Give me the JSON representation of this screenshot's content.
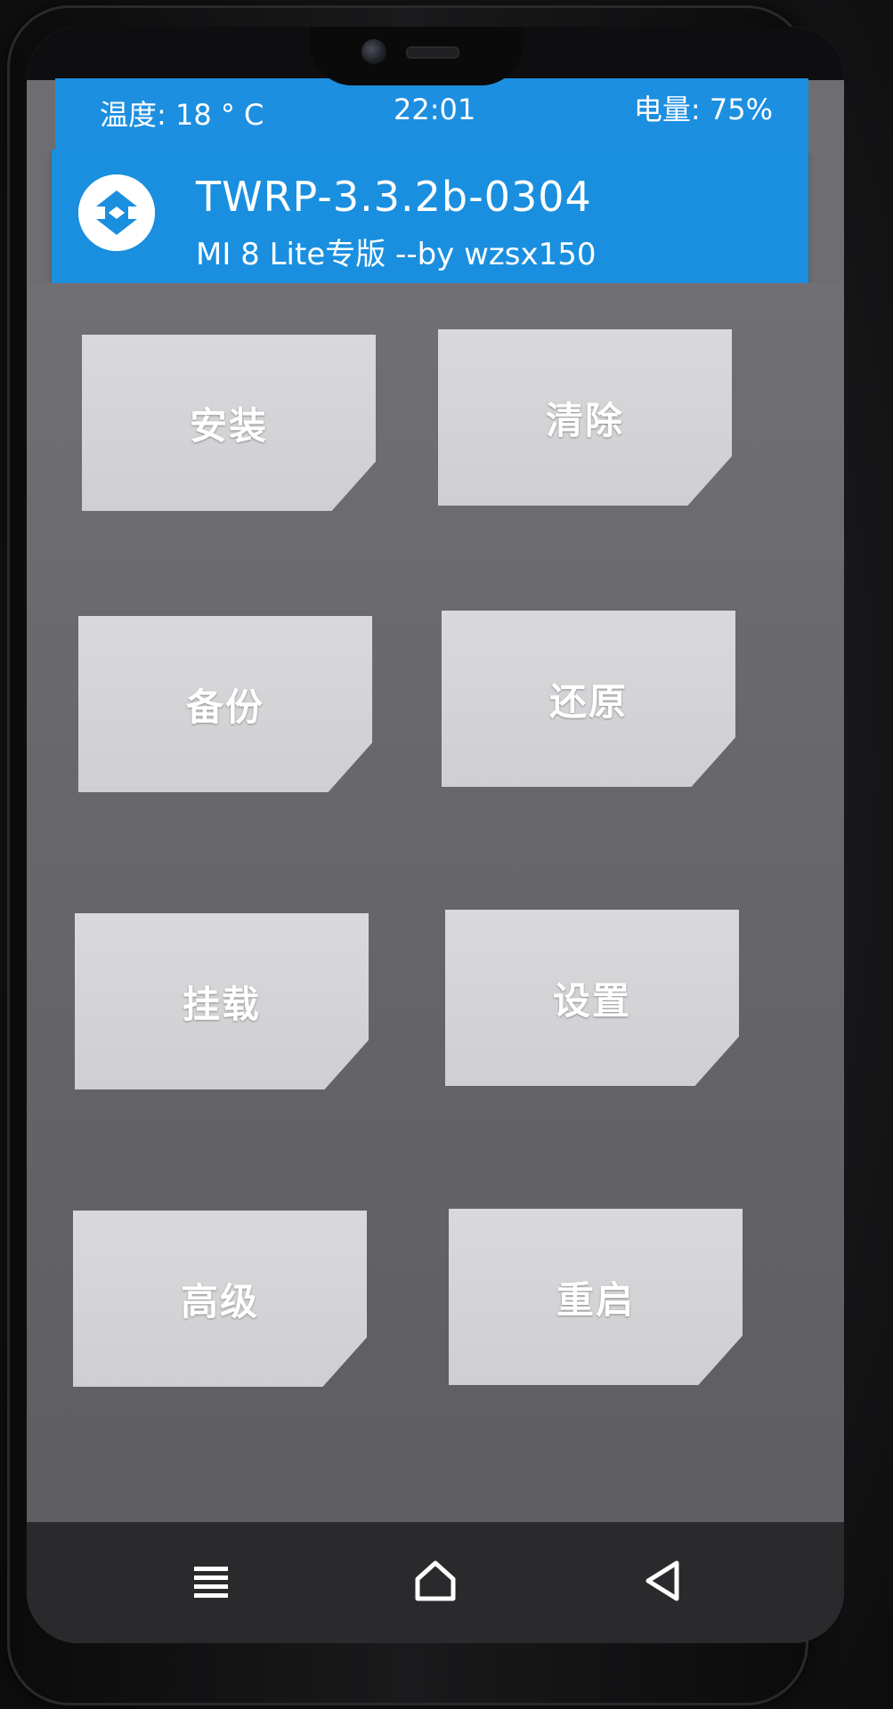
{
  "status_bar": {
    "temperature": "温度: 18 ° C",
    "time": "22:01",
    "battery": "电量: 75%"
  },
  "header": {
    "title": "TWRP-3.3.2b-0304",
    "subtitle": "MI 8 Lite专版  --by wzsx150",
    "logo_icon": "twrp-logo-icon"
  },
  "menu": {
    "items": [
      {
        "label": "安装"
      },
      {
        "label": "清除"
      },
      {
        "label": "备份"
      },
      {
        "label": "还原"
      },
      {
        "label": "挂载"
      },
      {
        "label": "设置"
      },
      {
        "label": "高级"
      },
      {
        "label": "重启"
      }
    ]
  },
  "navbar": {
    "icons": [
      "menu-icon",
      "home-icon",
      "back-icon"
    ]
  },
  "colors": {
    "accent": "#1a8fdf",
    "tile": "#d4d4d7",
    "background": "#6a6a6e"
  }
}
